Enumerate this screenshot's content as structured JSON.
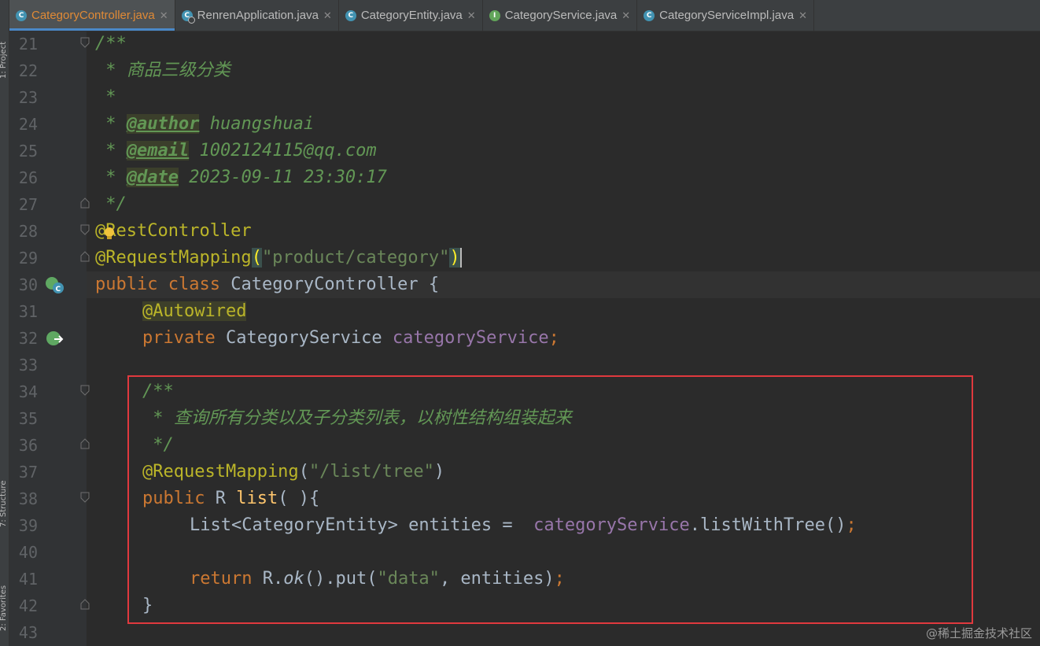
{
  "tool_windows": {
    "project_label": "1: Project",
    "structure_label": "7: Structure",
    "favorites_label": "2: Favorites"
  },
  "tabs": [
    {
      "label": "CategoryController.java",
      "icon": "class-icon",
      "active": true
    },
    {
      "label": "RenrenApplication.java",
      "icon": "app-class-icon",
      "active": false
    },
    {
      "label": "CategoryEntity.java",
      "icon": "class-icon",
      "active": false
    },
    {
      "label": "CategoryService.java",
      "icon": "interface-icon",
      "active": false
    },
    {
      "label": "CategoryServiceImpl.java",
      "icon": "class-icon",
      "active": false
    }
  ],
  "editor": {
    "line_numbers": [
      "21",
      "22",
      "23",
      "24",
      "25",
      "26",
      "27",
      "28",
      "29",
      "30",
      "31",
      "32",
      "33",
      "34",
      "35",
      "36",
      "37",
      "38",
      "39",
      "40",
      "41",
      "42",
      "43"
    ],
    "code": {
      "l21": "/**",
      "l22_star": " * ",
      "l22_text": "商品三级分类",
      "l23": " *",
      "l24_star": " * ",
      "l24_tag": "@author",
      "l24_text": " huangshuai",
      "l25_star": " * ",
      "l25_tag": "@email",
      "l25_text": " 1002124115@qq.com",
      "l26_star": " * ",
      "l26_tag": "@date",
      "l26_text": " 2023-09-11 23:30:17",
      "l27": " */",
      "l28_ann": "@RestController",
      "l29_ann": "@RequestMapping",
      "l29_str": "\"product/category\"",
      "l30_kw1": "public",
      "l30_kw2": "class",
      "l30_name": "CategoryController {",
      "l31_ann": "@Autowired",
      "l32_kw": "private",
      "l32_type": "CategoryService",
      "l32_field": "categoryService",
      "l34": "/**",
      "l35_star": " * ",
      "l35_text": "查询所有分类以及子分类列表，以树性结构组装起来",
      "l36": " */",
      "l37_ann": "@RequestMapping",
      "l37_str": "\"/list/tree\"",
      "l38_kw": "public",
      "l38_rest": " R ",
      "l38_method": "list",
      "l38_end": "( ){",
      "l39_type": "List<CategoryEntity> entities =  ",
      "l39_field": "categoryService",
      "l39_call": ".listWithTree()",
      "l41_kw": "return",
      "l41_r": " R.",
      "l41_ok": "ok",
      "l41_put": "().put(",
      "l41_str": "\"data\"",
      "l41_end": ", entities)",
      "l42": "}"
    }
  },
  "watermark": "@稀土掘金技术社区",
  "colors": {
    "comment": "#629755",
    "annotation": "#bbb529",
    "keyword": "#cc7832",
    "string": "#6a8759",
    "field": "#9876aa",
    "highlight_box": "#e0393e"
  }
}
